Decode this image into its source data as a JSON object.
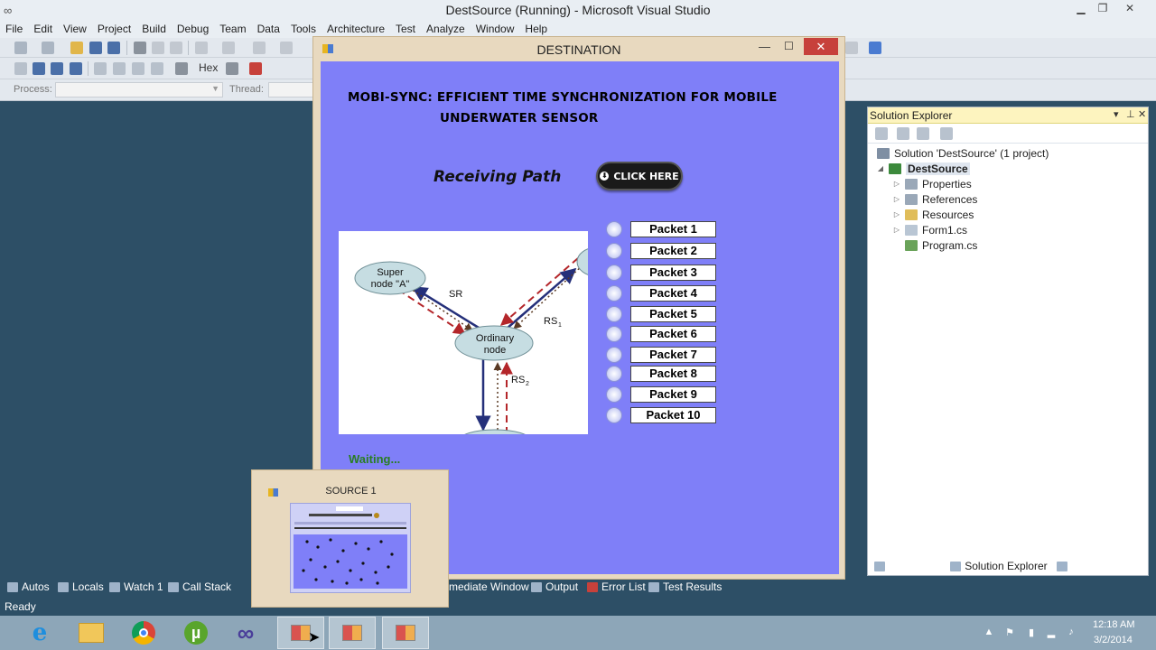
{
  "vs": {
    "title": "DestSource (Running) - Microsoft Visual Studio",
    "menu": [
      "File",
      "Edit",
      "View",
      "Project",
      "Build",
      "Debug",
      "Team",
      "Data",
      "Tools",
      "Architecture",
      "Test",
      "Analyze",
      "Window",
      "Help"
    ],
    "toolbar": {
      "hex_label": "Hex",
      "process_label": "Process:",
      "thread_label": "Thread:"
    },
    "status": "Ready",
    "bottom_tabs": [
      "Autos",
      "Locals",
      "Watch 1",
      "Call Stack",
      "mediate Window",
      "Output",
      "Error List",
      "Test Results"
    ]
  },
  "solution_explorer": {
    "title": "Solution Explorer",
    "solution_label": "Solution 'DestSource' (1 project)",
    "project_label": "DestSource",
    "items": [
      "Properties",
      "References",
      "Resources",
      "Form1.cs",
      "Program.cs"
    ],
    "tabs": [
      "IntelliTrace",
      "Solution Explorer",
      "Team Explorer"
    ]
  },
  "destination_form": {
    "title": "DESTINATION",
    "heading_line1": "MOBI-SYNC: EFFICIENT TIME SYNCHRONIZATION FOR MOBILE",
    "heading_line2": "UNDERWATER SENSOR",
    "receiving_path": "Receiving Path",
    "click_here": "CLICK HERE",
    "packets": [
      "Packet 1",
      "Packet 2",
      "Packet 3",
      "Packet 4",
      "Packet 5",
      "Packet 6",
      "Packet 7",
      "Packet 8",
      "Packet 9",
      "Packet 10"
    ],
    "status": "Waiting...",
    "diagram": {
      "super_node_line1": "Super",
      "super_node_line2": "node \"A\"",
      "ordinary_line1": "Ordinary",
      "ordinary_line2": "node",
      "label_sr": "SR",
      "label_rs1": "RS",
      "label_rs1_sub": "1",
      "label_rs2": "RS",
      "label_rs2_sub": "2"
    }
  },
  "thumbnail": {
    "title": "SOURCE 1"
  },
  "taskbar": {
    "time": "12:18 AM",
    "date": "3/2/2014"
  },
  "colors": {
    "form_client": "#7f7ff8",
    "waiting_green": "#2a7d23",
    "close_red": "#c7413b"
  }
}
